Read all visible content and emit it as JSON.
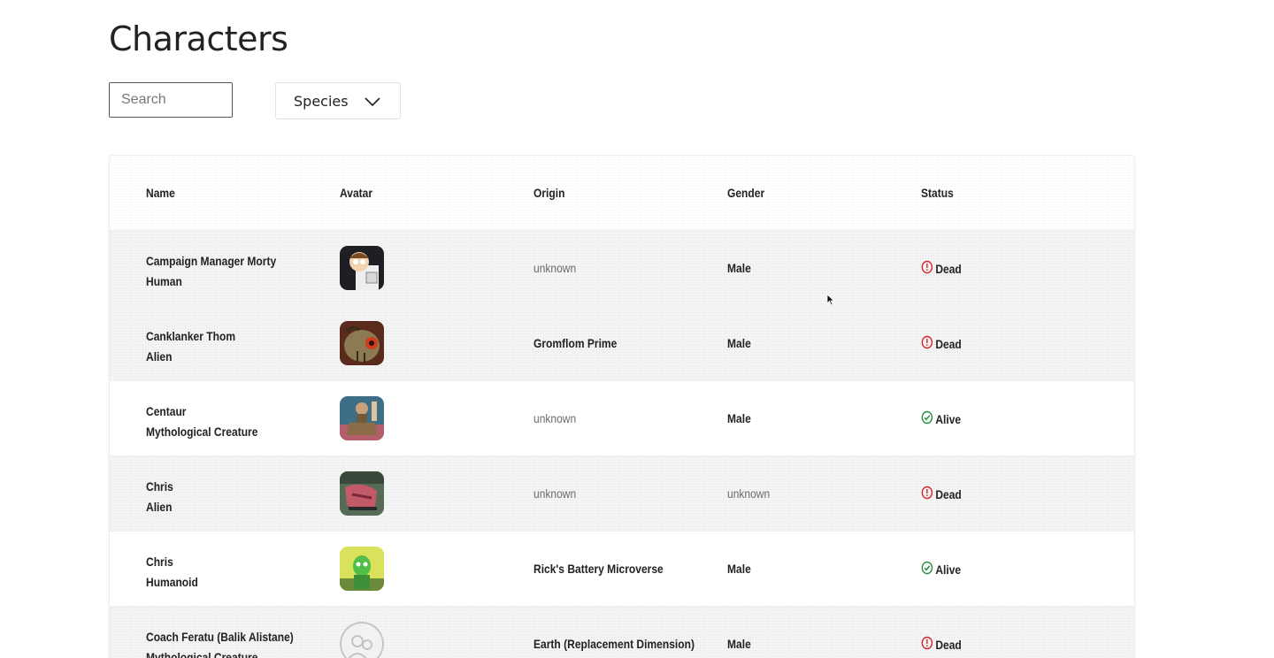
{
  "page": {
    "title": "Characters"
  },
  "filters": {
    "search_placeholder": "Search",
    "species_label": "Species"
  },
  "table": {
    "headers": {
      "name": "Name",
      "avatar": "Avatar",
      "origin": "Origin",
      "gender": "Gender",
      "status": "Status"
    },
    "rows": [
      {
        "name": "Campaign Manager Morty",
        "species": "Human",
        "origin": "unknown",
        "gender": "Male",
        "status": "Dead"
      },
      {
        "name": "Canklanker Thom",
        "species": "Alien",
        "origin": "Gromflom Prime",
        "gender": "Male",
        "status": "Dead"
      },
      {
        "name": "Centaur",
        "species": "Mythological Creature",
        "origin": "unknown",
        "gender": "Male",
        "status": "Alive"
      },
      {
        "name": "Chris",
        "species": "Alien",
        "origin": "unknown",
        "gender": "unknown",
        "status": "Dead"
      },
      {
        "name": "Chris",
        "species": "Humanoid",
        "origin": "Rick's Battery Microverse",
        "gender": "Male",
        "status": "Alive"
      },
      {
        "name": "Coach Feratu (Balik Alistane)",
        "species": "Mythological Creature",
        "origin": "Earth (Replacement Dimension)",
        "gender": "Male",
        "status": "Dead"
      }
    ]
  },
  "colors": {
    "dead": "#d4202c",
    "alive": "#1f8a3a",
    "text": "#222222",
    "muted": "#6c6c6c"
  },
  "icons": {
    "dropdown": "chevron-down-icon",
    "dead": "alert-circle-icon",
    "alive": "check-circle-icon",
    "cursor": "mouse-pointer-icon"
  }
}
